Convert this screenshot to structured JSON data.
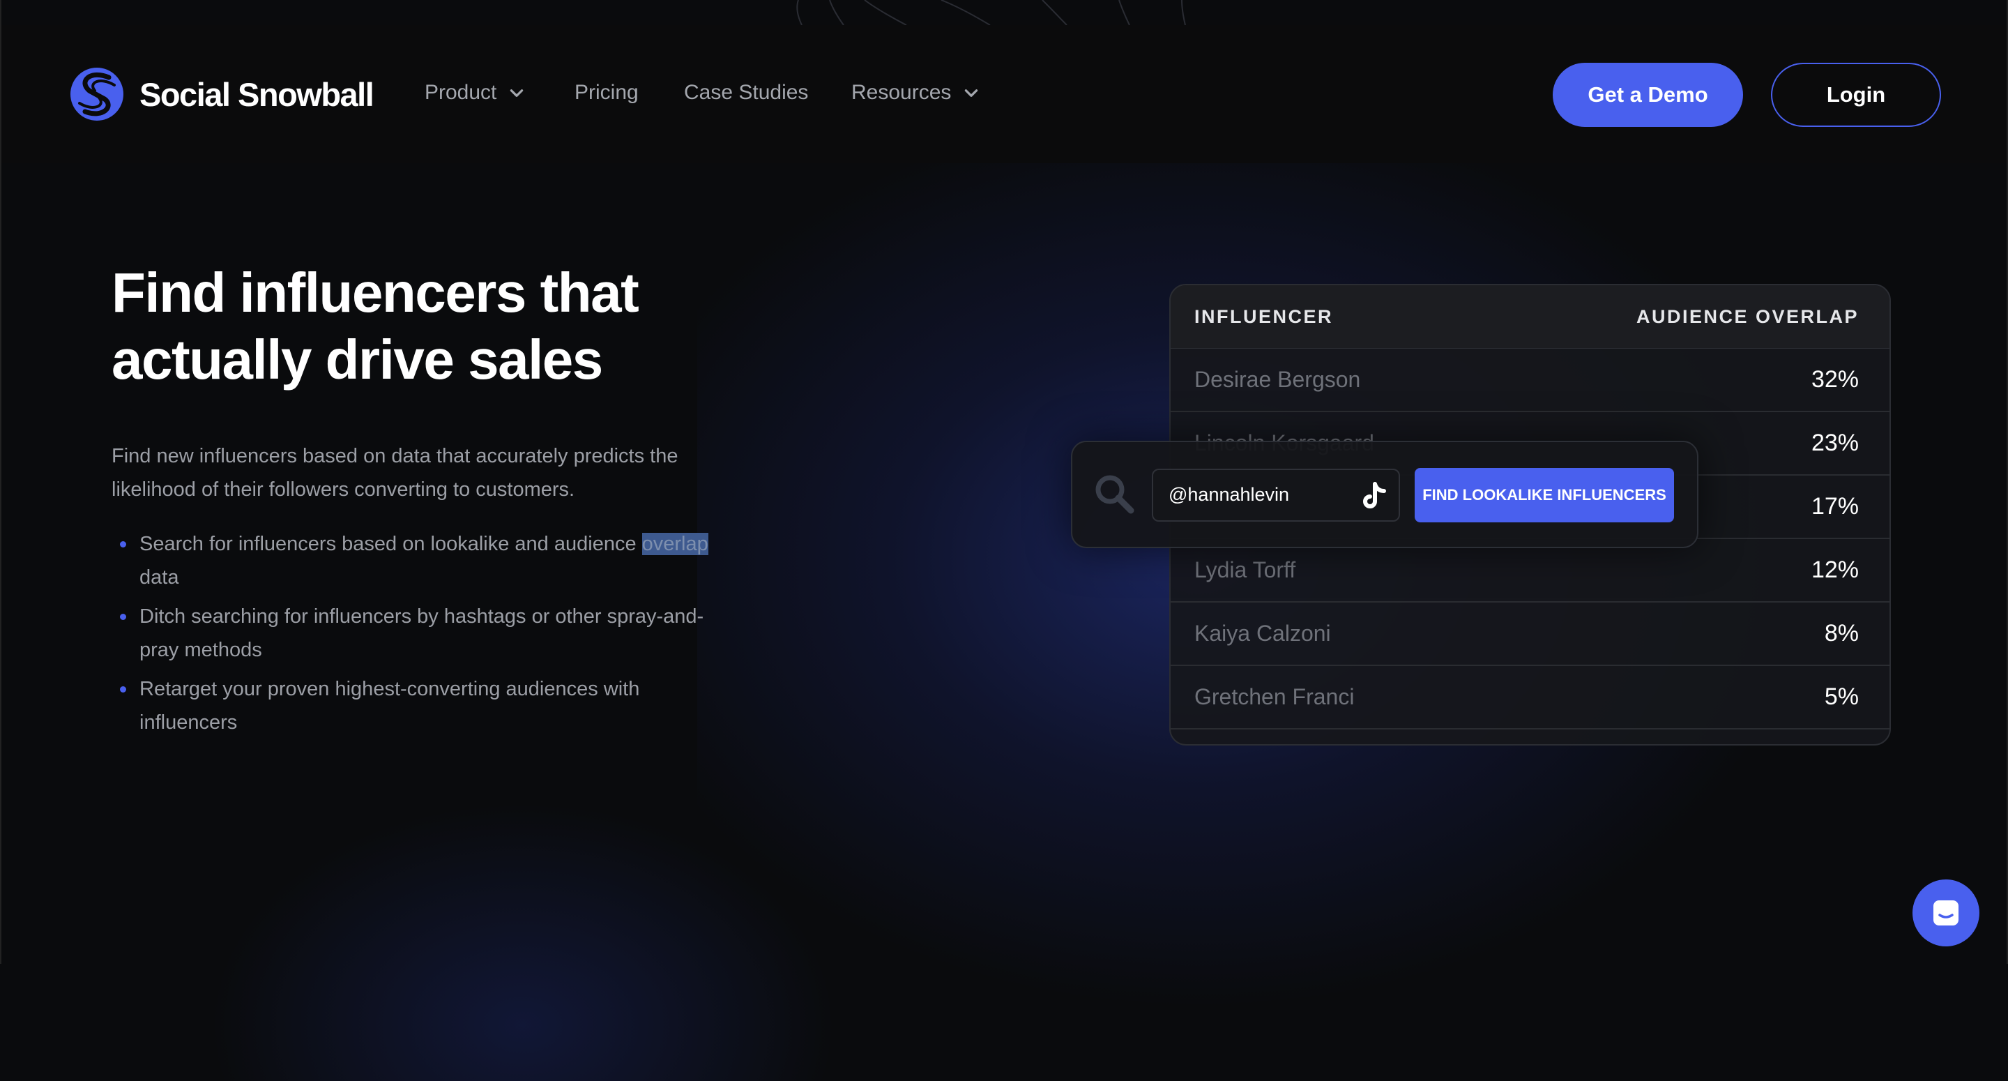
{
  "brand": {
    "name": "Social Snowball"
  },
  "nav": {
    "items": [
      {
        "label": "Product",
        "has_dropdown": true
      },
      {
        "label": "Pricing",
        "has_dropdown": false
      },
      {
        "label": "Case Studies",
        "has_dropdown": false
      },
      {
        "label": "Resources",
        "has_dropdown": true
      }
    ],
    "demo_label": "Get a Demo",
    "login_label": "Login"
  },
  "hero": {
    "headline": "Find influencers that actually drive sales",
    "subtitle": "Find new influencers based on data that accurately predicts the likelihood of their followers converting to customers.",
    "bullet_1_before": "Search for influencers based on lookalike and audience ",
    "bullet_1_highlight": "overlap",
    "bullet_1_after": " data",
    "bullet_2": "Ditch searching for influencers by hashtags or other spray-and-pray methods",
    "bullet_3": "Retarget your proven highest-converting audiences with influencers"
  },
  "table": {
    "col_influencer": "INFLUENCER",
    "col_overlap": "AUDIENCE OVERLAP",
    "rows": [
      {
        "name": "Desirae Bergson",
        "overlap": "32%"
      },
      {
        "name": "Lincoln Korsgaard",
        "overlap": "23%"
      },
      {
        "name": "",
        "overlap": "17%"
      },
      {
        "name": "Lydia Torff",
        "overlap": "12%"
      },
      {
        "name": "Kaiya Calzoni",
        "overlap": "8%"
      },
      {
        "name": "Gretchen Franci",
        "overlap": "5%"
      }
    ]
  },
  "search": {
    "handle": "@hannahlevin",
    "platform_icon": "tiktok-icon",
    "button_label": "FIND LOOKALIKE INFLUENCERS"
  },
  "colors": {
    "accent": "#4960ee",
    "background": "#0a0b0d"
  }
}
